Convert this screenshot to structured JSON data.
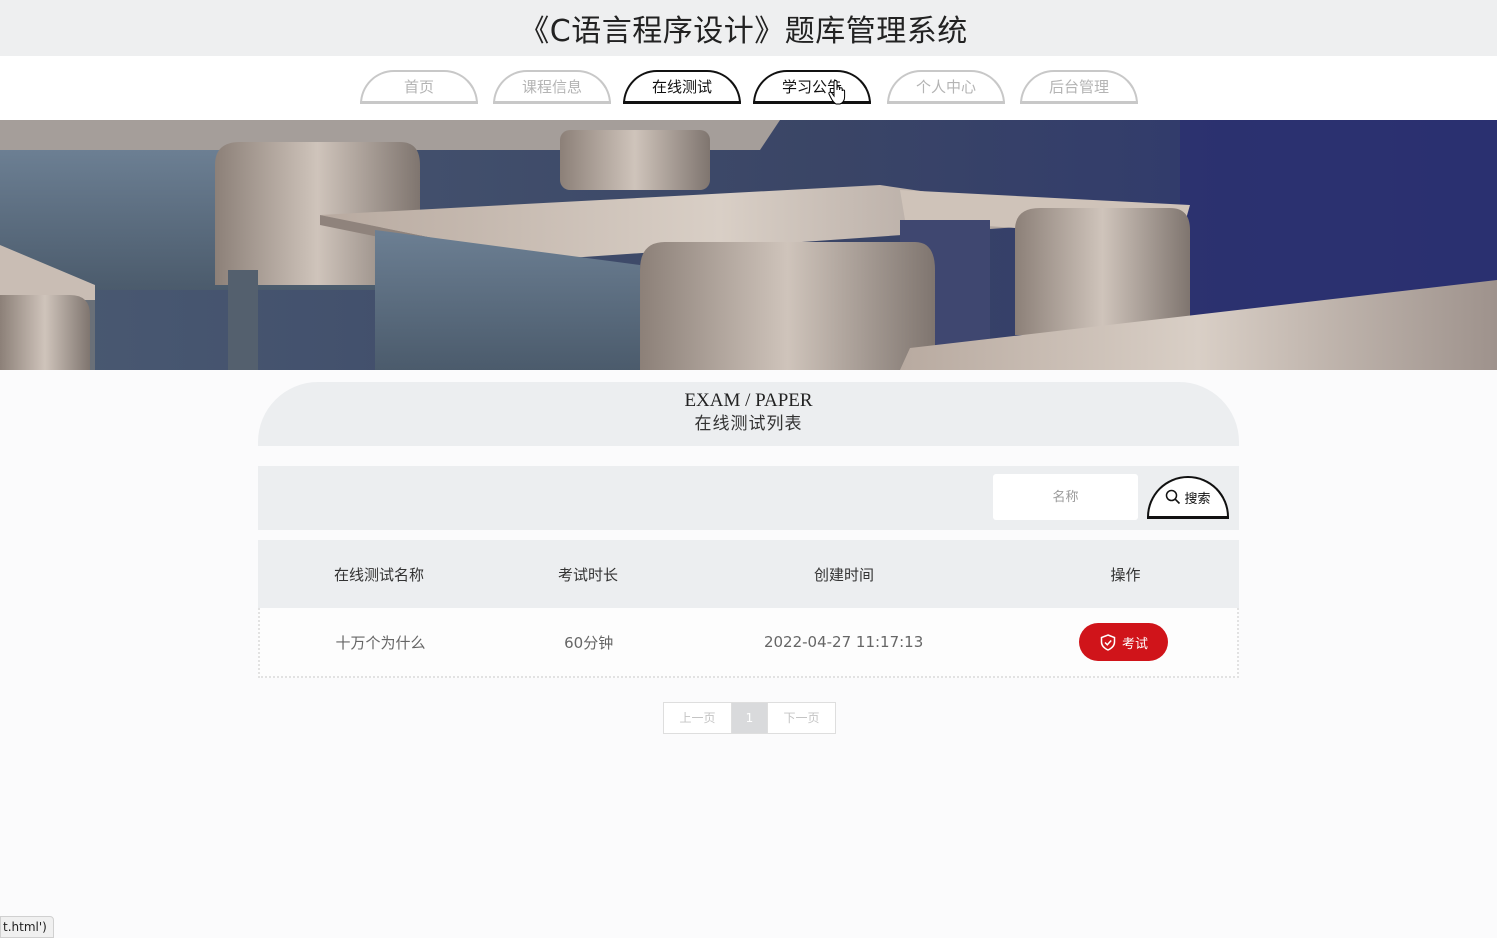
{
  "header": {
    "title": "《C语言程序设计》题库管理系统"
  },
  "nav": {
    "items": [
      {
        "label": "首页"
      },
      {
        "label": "课程信息"
      },
      {
        "label": "在线测试"
      },
      {
        "label": "学习公告"
      },
      {
        "label": "个人中心"
      },
      {
        "label": "后台管理"
      }
    ],
    "active_label": "在线测试"
  },
  "section": {
    "title_en": "EXAM / PAPER",
    "title_cn": "在线测试列表"
  },
  "search": {
    "placeholder": "名称",
    "value": "",
    "button_label": "搜索",
    "button_icon": "search-icon"
  },
  "table": {
    "headers": [
      "在线测试名称",
      "考试时长",
      "创建时间",
      "操作"
    ],
    "rows": [
      {
        "name": "十万个为什么",
        "duration": "60分钟",
        "created": "2022-04-27 11:17:13",
        "action_label": "考试",
        "action_icon": "shield-check-icon"
      }
    ]
  },
  "pagination": {
    "prev_label": "上一页",
    "current_page": "1",
    "next_label": "下一页"
  },
  "status_bar": {
    "text": "t.html')"
  },
  "colors": {
    "accent_red": "#d0141a",
    "panel_gray": "#eceef0",
    "topbar_gray": "#eeeff0"
  }
}
